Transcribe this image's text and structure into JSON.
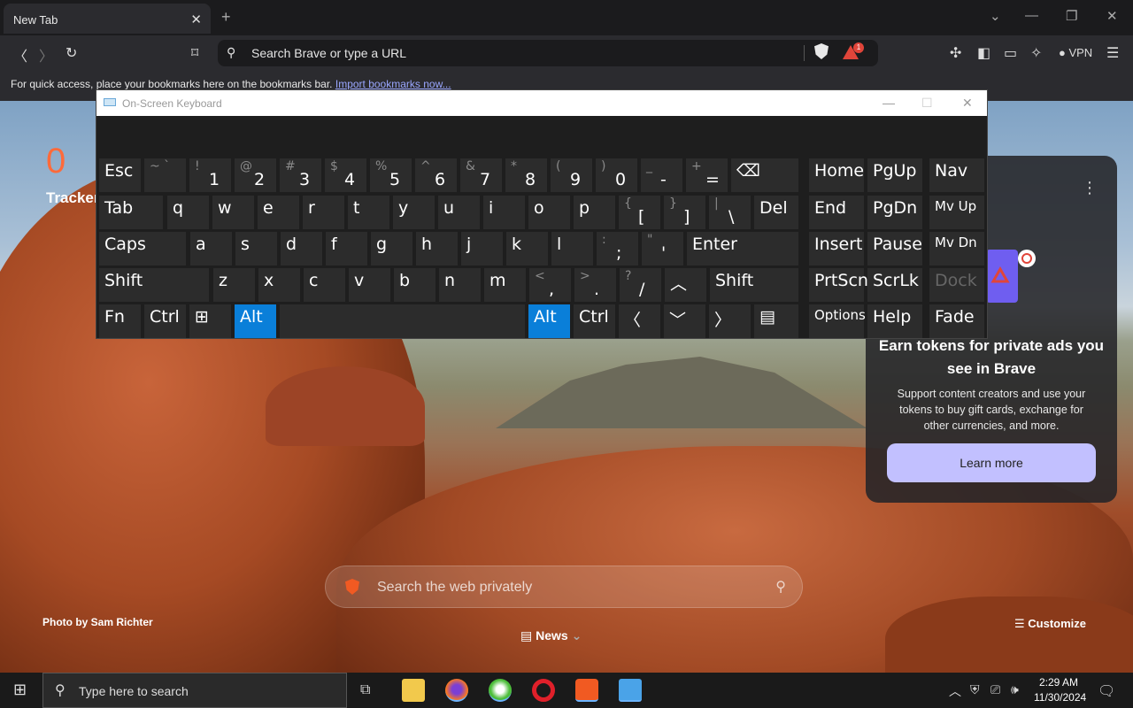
{
  "browser": {
    "tab_title": "New Tab",
    "address_placeholder": "Search Brave or type a URL",
    "rewards_badge": "1",
    "vpn_label": "VPN",
    "bookmarks_bar_text": "For quick access, place your bookmarks here on the bookmarks bar.",
    "bookmarks_bar_link": "Import bookmarks now..."
  },
  "osk": {
    "title": "On-Screen Keyboard",
    "keys": [
      {
        "id": "esc",
        "label": "Esc"
      },
      {
        "id": "tilde",
        "shift": "~ `",
        "low": ""
      },
      {
        "id": "1",
        "shift": "!",
        "low": "1"
      },
      {
        "id": "2",
        "shift": "@",
        "low": "2"
      },
      {
        "id": "3",
        "shift": "#",
        "low": "3"
      },
      {
        "id": "4",
        "shift": "$",
        "low": "4"
      },
      {
        "id": "5",
        "shift": "%",
        "low": "5"
      },
      {
        "id": "6",
        "shift": "^",
        "low": "6"
      },
      {
        "id": "7",
        "shift": "&",
        "low": "7"
      },
      {
        "id": "8",
        "shift": "*",
        "low": "8"
      },
      {
        "id": "9",
        "shift": "(",
        "low": "9"
      },
      {
        "id": "0",
        "shift": ")",
        "low": "0"
      },
      {
        "id": "minus",
        "shift": "_",
        "low": "-"
      },
      {
        "id": "equals",
        "shift": "+",
        "low": "="
      },
      {
        "id": "backspace",
        "label": "⌫"
      },
      {
        "id": "home",
        "label": "Home"
      },
      {
        "id": "pgup",
        "label": "PgUp"
      },
      {
        "id": "nav",
        "label": "Nav"
      },
      {
        "id": "tab",
        "label": "Tab"
      },
      {
        "id": "q",
        "label": "q"
      },
      {
        "id": "w",
        "label": "w"
      },
      {
        "id": "e",
        "label": "e"
      },
      {
        "id": "r",
        "label": "r"
      },
      {
        "id": "t",
        "label": "t"
      },
      {
        "id": "y",
        "label": "y"
      },
      {
        "id": "u",
        "label": "u"
      },
      {
        "id": "i",
        "label": "i"
      },
      {
        "id": "o",
        "label": "o"
      },
      {
        "id": "p",
        "label": "p"
      },
      {
        "id": "lbracket",
        "shift": "{",
        "low": "["
      },
      {
        "id": "rbracket",
        "shift": "}",
        "low": "]"
      },
      {
        "id": "backslash",
        "shift": "|",
        "low": "\\"
      },
      {
        "id": "del",
        "label": "Del"
      },
      {
        "id": "end",
        "label": "End"
      },
      {
        "id": "pgdn",
        "label": "PgDn"
      },
      {
        "id": "mvup",
        "label": "Mv Up"
      },
      {
        "id": "caps",
        "label": "Caps"
      },
      {
        "id": "a",
        "label": "a"
      },
      {
        "id": "s",
        "label": "s"
      },
      {
        "id": "d",
        "label": "d"
      },
      {
        "id": "f",
        "label": "f"
      },
      {
        "id": "g",
        "label": "g"
      },
      {
        "id": "h",
        "label": "h"
      },
      {
        "id": "j",
        "label": "j"
      },
      {
        "id": "k",
        "label": "k"
      },
      {
        "id": "l",
        "label": "l"
      },
      {
        "id": "semicolon",
        "shift": ":",
        "low": ";"
      },
      {
        "id": "quote",
        "shift": "\"",
        "low": "'"
      },
      {
        "id": "enter",
        "label": "Enter"
      },
      {
        "id": "insert",
        "label": "Insert"
      },
      {
        "id": "pause",
        "label": "Pause"
      },
      {
        "id": "mvdn",
        "label": "Mv Dn"
      },
      {
        "id": "lshift",
        "label": "Shift"
      },
      {
        "id": "z",
        "label": "z"
      },
      {
        "id": "x",
        "label": "x"
      },
      {
        "id": "c",
        "label": "c"
      },
      {
        "id": "v",
        "label": "v"
      },
      {
        "id": "b",
        "label": "b"
      },
      {
        "id": "n",
        "label": "n"
      },
      {
        "id": "m",
        "label": "m"
      },
      {
        "id": "comma",
        "shift": "<",
        "low": ","
      },
      {
        "id": "period",
        "shift": ">",
        "low": "."
      },
      {
        "id": "slash",
        "shift": "?",
        "low": "/"
      },
      {
        "id": "up",
        "label": "︿"
      },
      {
        "id": "rshift",
        "label": "Shift"
      },
      {
        "id": "prtscn",
        "label": "PrtScn"
      },
      {
        "id": "scrlk",
        "label": "ScrLk"
      },
      {
        "id": "dock",
        "label": "Dock"
      },
      {
        "id": "fn",
        "label": "Fn"
      },
      {
        "id": "lctrl",
        "label": "Ctrl"
      },
      {
        "id": "win",
        "label": "⊞"
      },
      {
        "id": "lalt",
        "label": "Alt"
      },
      {
        "id": "space",
        "label": ""
      },
      {
        "id": "ralt",
        "label": "Alt"
      },
      {
        "id": "rctrl",
        "label": "Ctrl"
      },
      {
        "id": "left",
        "label": "〈"
      },
      {
        "id": "down",
        "label": "﹀"
      },
      {
        "id": "right",
        "label": "〉"
      },
      {
        "id": "menu",
        "label": "▤"
      },
      {
        "id": "options",
        "label": "Options"
      },
      {
        "id": "help",
        "label": "Help"
      },
      {
        "id": "fade",
        "label": "Fade"
      }
    ]
  },
  "ntp": {
    "trackers_count": "0",
    "trackers_label": "Tracker",
    "search_placeholder": "Search the web privately",
    "photo_credit": "Photo by Sam Richter",
    "news_label": "News",
    "customize_label": "Customize"
  },
  "rewards_card": {
    "heading": "Earn tokens for private ads you see in Brave",
    "body": "Support content creators and use your tokens to buy gift cards, exchange for other currencies, and more.",
    "button": "Learn more"
  },
  "taskbar": {
    "search_placeholder": "Type here to search",
    "time": "2:29 AM",
    "date": "11/30/2024"
  },
  "colors": {
    "accent_alt_key": "#0a7fd9",
    "brave_orange": "#f15a22",
    "learn_more_button": "#c2c0ff"
  }
}
